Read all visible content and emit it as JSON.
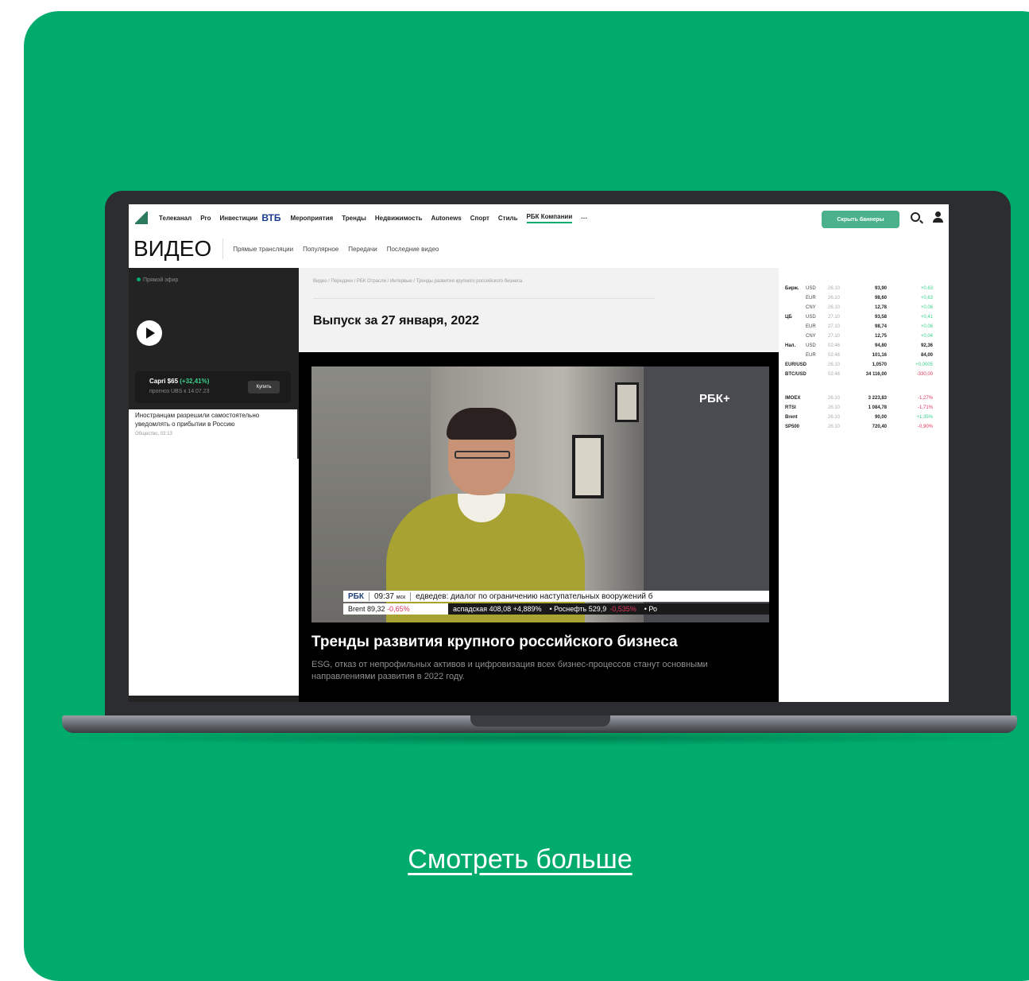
{
  "topnav": {
    "items": [
      "Телеканал",
      "Pro",
      "Инвестиции"
    ],
    "vtb": "ВТБ",
    "items2": [
      "Мероприятия",
      "Тренды",
      "Недвижимость",
      "Autonews",
      "Спорт",
      "Стиль",
      "РБК Компании",
      "···"
    ],
    "hide_banners": "Скрыть баннеры"
  },
  "section": {
    "title": "ВИДЕО",
    "subnav": [
      "Прямые трансляции",
      "Популярное",
      "Передачи",
      "Последние видео"
    ]
  },
  "live": {
    "label": "Прямой эфир",
    "promo_line1": "Capri $65",
    "promo_change": "(+32,41%)",
    "promo_line2": "прогноз UBS к 14.07.23",
    "promo_buy": "Купить"
  },
  "side_news": {
    "headline": "Иностранцам разрешили самостоятельно уведомлять о прибытии в Россию",
    "meta": "Общество, 02:13"
  },
  "main": {
    "breadcrumb": "Видео / Передачи / РБК Отрасли / Интервью / Тренды развития крупного российского бизнеса",
    "episode": "Выпуск за 27 января, 2022",
    "rbk_plus": "РБК+",
    "ticker_brand": "РБК",
    "ticker_time": "09:37",
    "ticker_msk": "мск",
    "ticker_text": "едведев: диалог по ограничению наступательных вооружений б",
    "brent_label": "Brent 89,32",
    "brent_change": "-0,65%",
    "ticker2_a": "аспадская 408,08 +4,889%",
    "ticker2_b": "•   Роснефть 529,9",
    "ticker2_b_change": "-0,535%",
    "ticker2_c": "•   Ро",
    "video_title": "Тренды развития крупного российского бизнеса",
    "video_desc": "ESG, отказ от непрофильных активов и цифровизация всех бизнес-процессов станут основными направлениями развития в 2022 году."
  },
  "quotes": {
    "rows1": [
      {
        "group": "Бирж.",
        "cur": "USD",
        "date": "26.10",
        "value": "93,90",
        "change": "+0,63",
        "dir": "pos"
      },
      {
        "group": "",
        "cur": "EUR",
        "date": "26.10",
        "value": "98,60",
        "change": "+0,63",
        "dir": "pos"
      },
      {
        "group": "",
        "cur": "CNY",
        "date": "26.10",
        "value": "12,78",
        "change": "+0,06",
        "dir": "pos"
      },
      {
        "group": "ЦБ",
        "cur": "USD",
        "date": "27.10",
        "value": "93,58",
        "change": "+0,41",
        "dir": "pos"
      },
      {
        "group": "",
        "cur": "EUR",
        "date": "27.10",
        "value": "98,74",
        "change": "+0,06",
        "dir": "pos"
      },
      {
        "group": "",
        "cur": "CNY",
        "date": "27.10",
        "value": "12,75",
        "change": "+0,04",
        "dir": "pos"
      },
      {
        "group": "Нал.",
        "cur": "USD",
        "date": "02:46",
        "value": "94,80",
        "change": "92,36",
        "dir": "plain"
      },
      {
        "group": "",
        "cur": "EUR",
        "date": "02:46",
        "value": "101,16",
        "change": "84,00",
        "dir": "plain"
      },
      {
        "group": "EUR/USD",
        "cur": "",
        "date": "26.10",
        "value": "1,0570",
        "change": "+0,0005",
        "dir": "pos"
      },
      {
        "group": "BTC/USD",
        "cur": "",
        "date": "02:46",
        "value": "34 116,00",
        "change": "-330,00",
        "dir": "neg"
      }
    ],
    "rows2": [
      {
        "group": "IMOEX",
        "cur": "",
        "date": "26.10",
        "value": "3 223,83",
        "change": "-1,27%",
        "dir": "neg"
      },
      {
        "group": "RTSI",
        "cur": "",
        "date": "26.10",
        "value": "1 084,78",
        "change": "-1,71%",
        "dir": "neg"
      },
      {
        "group": "Brent",
        "cur": "",
        "date": "26.10",
        "value": "90,00",
        "change": "+1,35%",
        "dir": "pos"
      },
      {
        "group": "SP500",
        "cur": "",
        "date": "26.10",
        "value": "720,40",
        "change": "-0,90%",
        "dir": "neg"
      }
    ]
  },
  "footer": {
    "more_link": "Смотреть больше"
  },
  "colors": {
    "card": "#00ab6c",
    "button": "#4bb18a",
    "positive": "#3ccf8e",
    "negative": "#e0365a"
  }
}
